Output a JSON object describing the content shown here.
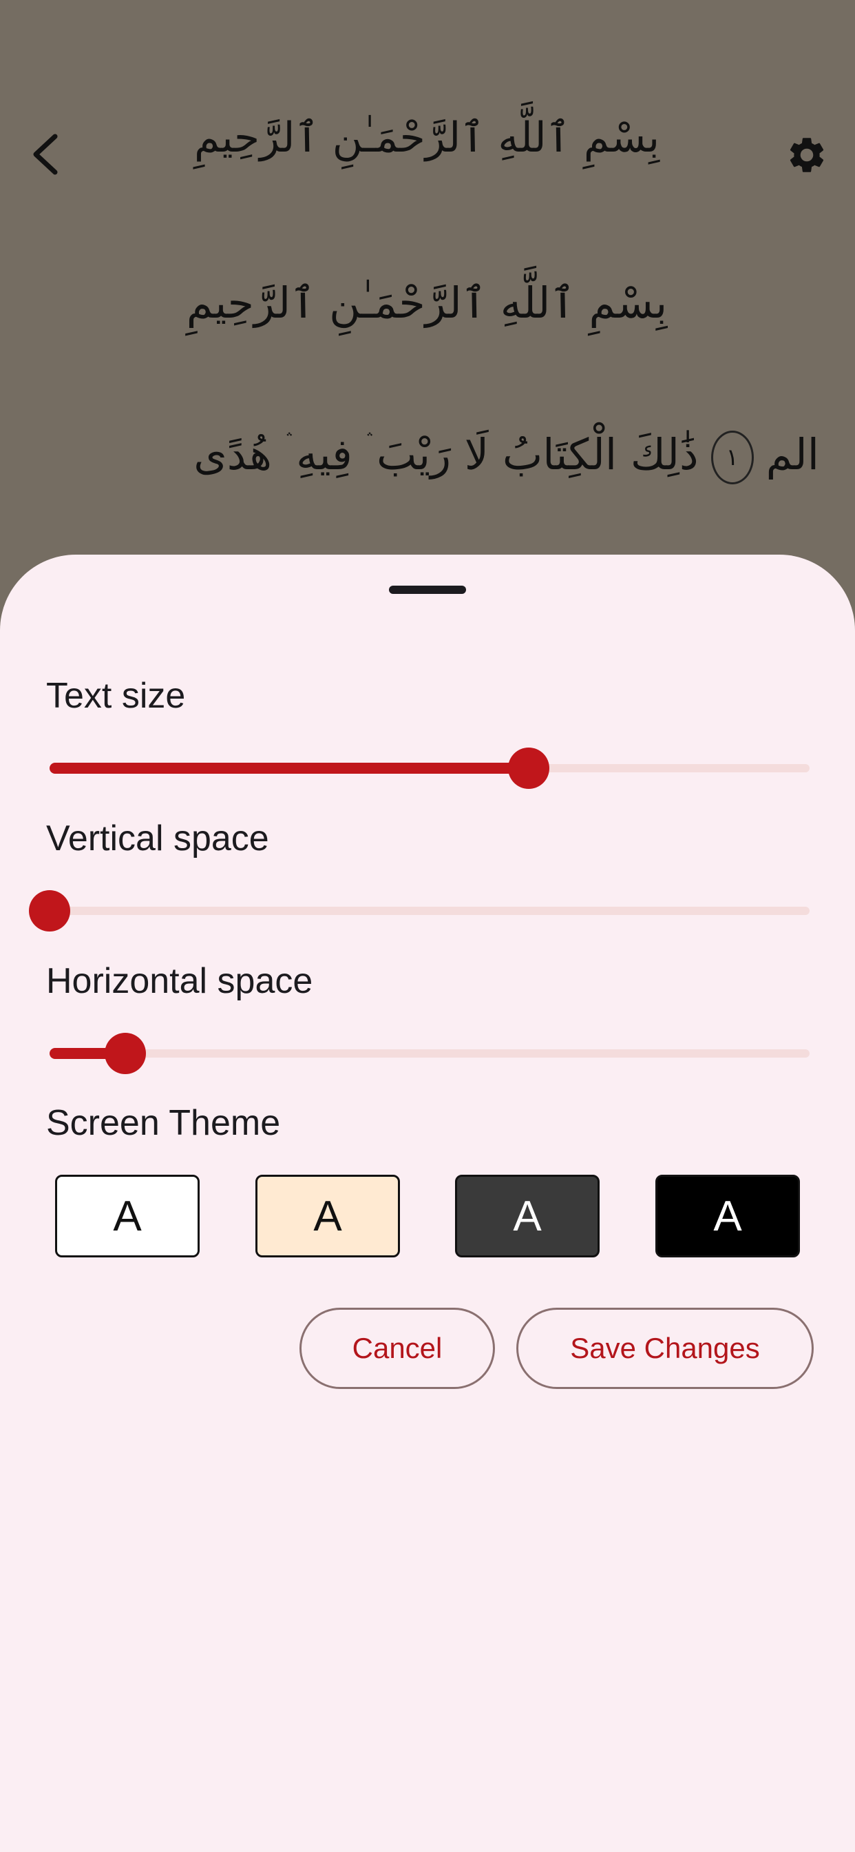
{
  "reader": {
    "surah_title": "بِسْمِ ٱللَّهِ ٱلرَّحْمَـٰنِ ٱلرَّحِيمِ",
    "basmala": "بِسْمِ ٱللَّهِ ٱلرَّحْمَـٰنِ ٱلرَّحِيمِ",
    "verse_1": "الم",
    "verse_1_number": "١",
    "verse_2": "ذَٰلِكَ الْكِتَابُ لَا رَيْبَ ۛ فِيهِ ۛ هُدًى",
    "back_icon": "chevron-left-icon",
    "settings_icon": "gear-icon"
  },
  "sheet": {
    "text_size": {
      "label": "Text size",
      "value_fraction": 0.63
    },
    "vertical_space": {
      "label": "Vertical space",
      "value_fraction": 0.0
    },
    "horizontal_space": {
      "label": "Horizontal space",
      "value_fraction": 0.1
    },
    "screen_theme": {
      "label": "Screen Theme",
      "options": [
        {
          "glyph": "A",
          "background": "#ffffff",
          "text_color": "#111111"
        },
        {
          "glyph": "A",
          "background": "#ffead2",
          "text_color": "#111111"
        },
        {
          "glyph": "A",
          "background": "#3a3a3a",
          "text_color": "#ffffff"
        },
        {
          "glyph": "A",
          "background": "#000000",
          "text_color": "#ffffff"
        }
      ]
    },
    "cancel_label": "Cancel",
    "save_label": "Save Changes"
  },
  "colors": {
    "accent": "#c0161b",
    "sheet_background": "#fbeef3",
    "scrim": "#756d62"
  }
}
